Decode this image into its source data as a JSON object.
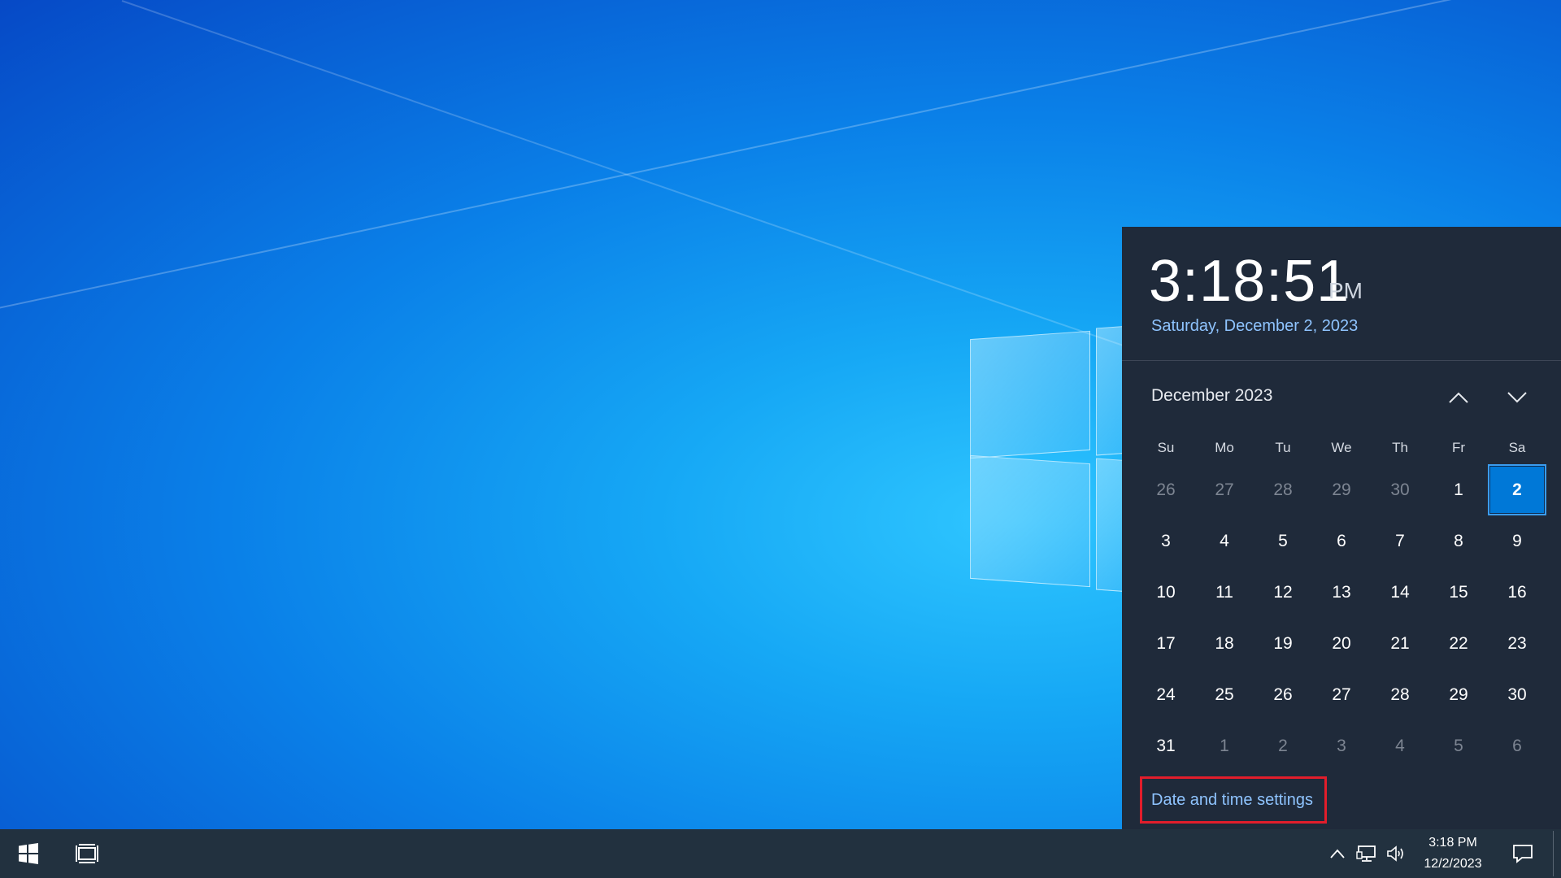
{
  "flyout": {
    "time": "3:18:51",
    "ampm": "PM",
    "date": "Saturday, December 2, 2023",
    "month_label": "December 2023",
    "weekdays": [
      "Su",
      "Mo",
      "Tu",
      "We",
      "Th",
      "Fr",
      "Sa"
    ],
    "days": [
      [
        "26",
        "27",
        "28",
        "29",
        "30",
        "1",
        "2"
      ],
      [
        "3",
        "4",
        "5",
        "6",
        "7",
        "8",
        "9"
      ],
      [
        "10",
        "11",
        "12",
        "13",
        "14",
        "15",
        "16"
      ],
      [
        "17",
        "18",
        "19",
        "20",
        "21",
        "22",
        "23"
      ],
      [
        "24",
        "25",
        "26",
        "27",
        "28",
        "29",
        "30"
      ],
      [
        "31",
        "1",
        "2",
        "3",
        "4",
        "5",
        "6"
      ]
    ],
    "settings_link": "Date and time settings"
  },
  "taskbar": {
    "clock_time": "3:18 PM",
    "clock_date": "12/2/2023"
  },
  "icons": {
    "start": "windows-logo-icon",
    "task_view": "task-view-icon",
    "tray": "chevron-up-icon",
    "network": "network-icon",
    "volume": "speaker-icon",
    "notifications": "notification-icon",
    "prev_month": "chevron-up-icon",
    "next_month": "chevron-down-icon"
  },
  "colors": {
    "flyout_bg": "#1f2a3a",
    "accent": "#0078d7",
    "link": "#8fc4ff",
    "highlight_box": "#e21d2b",
    "taskbar_bg": "#22313f"
  }
}
